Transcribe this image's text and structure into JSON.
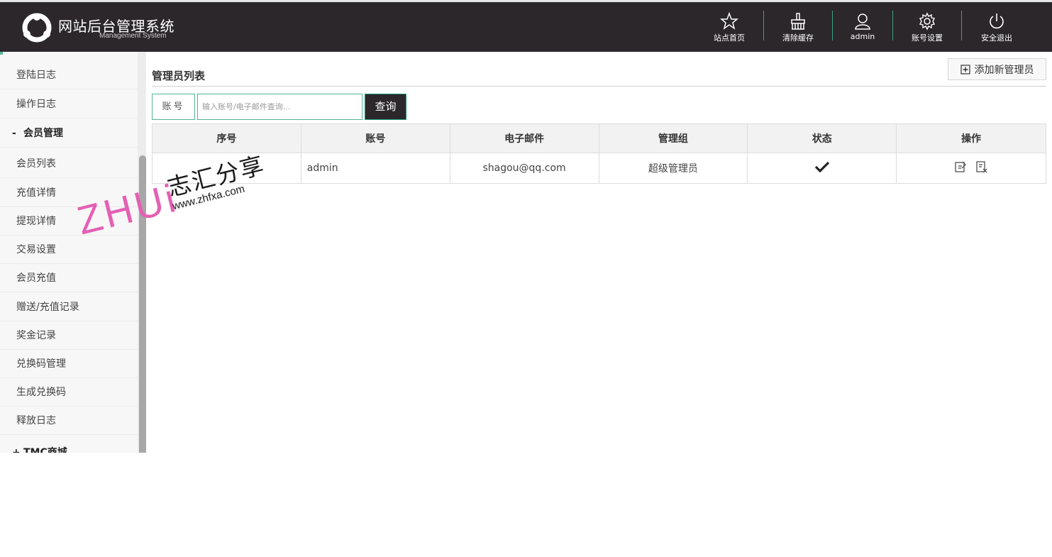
{
  "brand": {
    "title": "网站后台管理系统",
    "subtitle": "Management System"
  },
  "header_nav": [
    {
      "label": "站点首页",
      "icon": "star-icon"
    },
    {
      "label": "清除缓存",
      "icon": "broom-icon"
    },
    {
      "label": "admin",
      "icon": "user-icon"
    },
    {
      "label": "账号设置",
      "icon": "gear-icon"
    },
    {
      "label": "安全退出",
      "icon": "power-icon"
    }
  ],
  "sidebar": {
    "items": [
      {
        "label": "登陆日志"
      },
      {
        "label": "操作日志"
      },
      {
        "label": "会员管理",
        "group": true,
        "mark": "-"
      },
      {
        "label": "会员列表"
      },
      {
        "label": "充值详情"
      },
      {
        "label": "提现详情"
      },
      {
        "label": "交易设置"
      },
      {
        "label": "会员充值"
      },
      {
        "label": "赠送/充值记录"
      },
      {
        "label": "奖金记录"
      },
      {
        "label": "兑换码管理"
      },
      {
        "label": "生成兑换码"
      },
      {
        "label": "释放日志"
      },
      {
        "label": "TMC商城",
        "group": true,
        "mark": "+"
      }
    ]
  },
  "main": {
    "title": "管理员列表",
    "add_button": "添加新管理员",
    "search": {
      "label": "账号",
      "placeholder": "输入账号/电子邮件查询...",
      "button": "查询"
    },
    "table": {
      "columns": [
        "序号",
        "账号",
        "电子邮件",
        "管理组",
        "状态",
        "操作"
      ],
      "rows": [
        {
          "index": "",
          "account": "admin",
          "email": "shagou@qq.com",
          "group": "超级管理员",
          "status": "active"
        }
      ]
    }
  },
  "watermark": {
    "logo_text": "ZHUi",
    "cn_text": "志汇分享",
    "url": "www.zhfxa.com"
  },
  "colors": {
    "header_bg": "#2c272b",
    "accent": "#53b895",
    "sidebar_bg": "#f7f7f7"
  }
}
